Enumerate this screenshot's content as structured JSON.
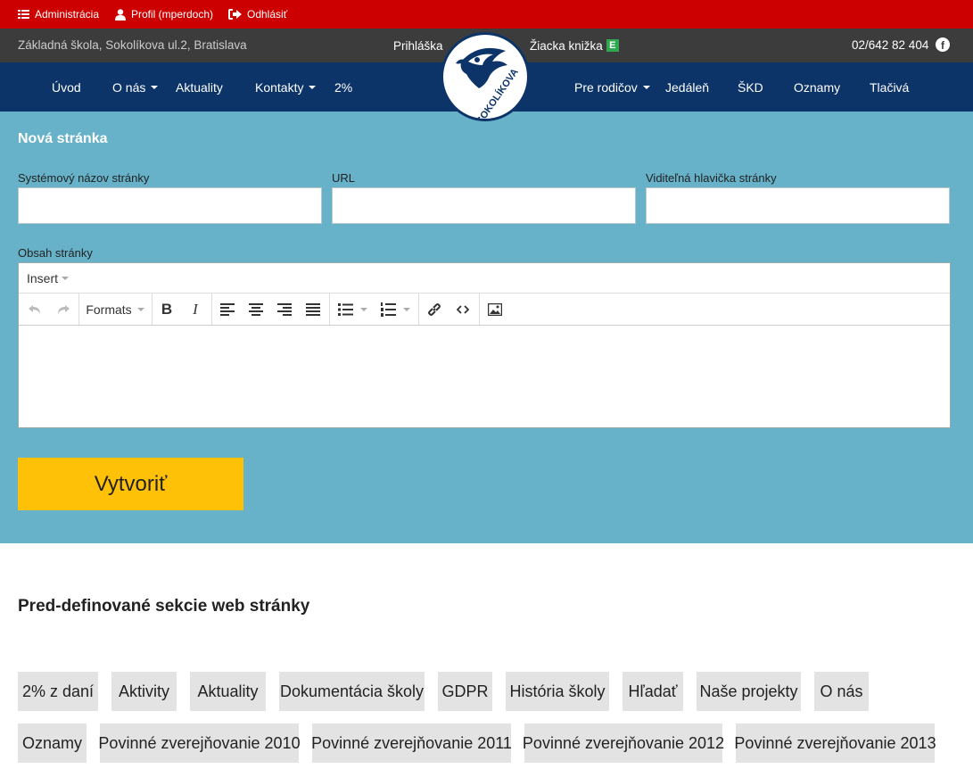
{
  "adminbar": {
    "admin_label": "Administrácia",
    "profile_label": "Profil (mperdoch)",
    "logout_label": "Odhlásiť"
  },
  "infobar": {
    "school": "Základná škola, Sokolíkova ul.2, Bratislava",
    "login": "Prihláška",
    "ziacka": "Žiacka knižka",
    "ziacka_badge": "E",
    "phone": "02/642 82 404",
    "fb_glyph": "f"
  },
  "logo": {
    "text": "ZŠ SOKOLÍKOVA"
  },
  "nav": {
    "left": [
      "Úvod",
      "O nás",
      "Aktuality",
      "Kontakty",
      "2%"
    ],
    "right": [
      "Pre rodičov",
      "Jedáleň",
      "ŠKD",
      "Oznamy",
      "Tlačivá"
    ]
  },
  "form": {
    "title": "Nová stránka",
    "system_name_label": "Systémový názov stránky",
    "system_name_value": "",
    "url_label": "URL",
    "url_value": "",
    "header_label": "Viditeľná hlavička stránky",
    "header_value": "",
    "content_label": "Obsah stránky",
    "editor_menu_insert": "Insert",
    "editor_formats": "Formats",
    "create_button": "Vytvoriť"
  },
  "sections": {
    "title": "Pred-definované sekcie web stránky",
    "row1": [
      "2% z daní",
      "Aktivity",
      "Aktuality",
      "Dokumentácia školy",
      "GDPR",
      "História školy",
      "Hľadať",
      "Naše projekty",
      "O nás"
    ],
    "row2": [
      "Oznamy",
      "Povinné zverejňovanie 2010",
      "Povinné zverejňovanie 2011",
      "Povinné zverejňovanie 2012",
      "Povinné zverejňovanie 2013"
    ]
  },
  "colors": {
    "adminbar": "#cc0000",
    "infobar": "#3c3c3c",
    "navbar": "#0c3468",
    "form_bg": "#67b2c8",
    "create_button": "#ffc107",
    "chip": "#e3e3e3"
  }
}
